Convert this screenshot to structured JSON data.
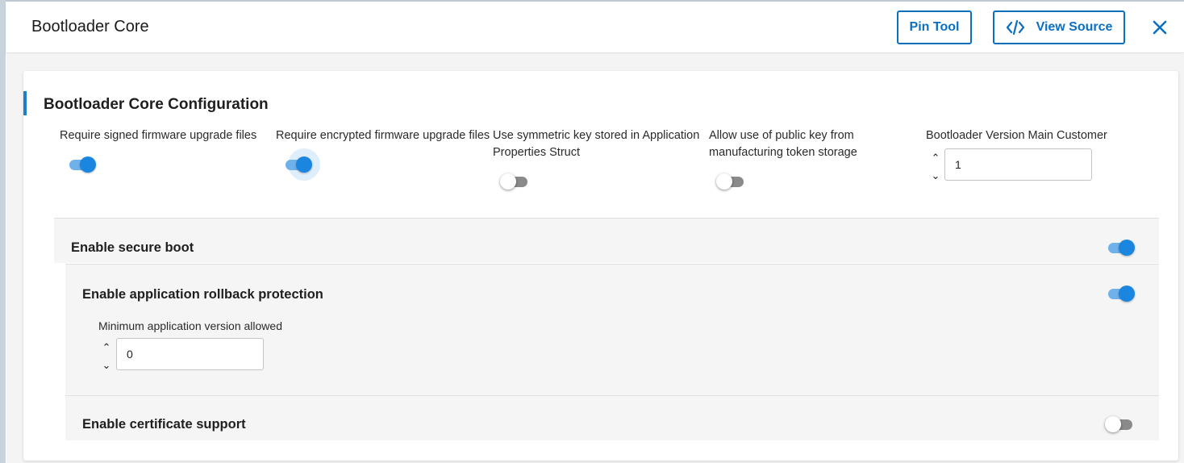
{
  "header": {
    "title": "Bootloader Core",
    "pin_tool_label": "Pin Tool",
    "view_source_label": "View Source"
  },
  "card": {
    "title": "Bootloader Core Configuration"
  },
  "options": [
    {
      "label": "Require signed firmware upgrade files",
      "enabled": true
    },
    {
      "label": "Require encrypted firmware upgrade files",
      "enabled": true,
      "focused": true
    },
    {
      "label_line1": "Use symmetric key stored in Application",
      "label_line2": "Properties Struct",
      "enabled": false
    },
    {
      "label_line1": "Allow use of public key from",
      "label_line2": "manufacturing token storage",
      "enabled": false
    }
  ],
  "version_main_customer": {
    "label": "Bootloader Version Main Customer",
    "value": "1"
  },
  "secure_boot": {
    "title": "Enable secure boot",
    "enabled": true
  },
  "rollback": {
    "title": "Enable application rollback protection",
    "enabled": true,
    "min_version_label": "Minimum application version allowed",
    "min_version_value": "0"
  },
  "certificate": {
    "title": "Enable certificate support",
    "enabled": false
  },
  "icons": {
    "stepper_up": "⌃",
    "stepper_down": "⌄"
  },
  "colors": {
    "accent": "#0c6fc0",
    "toggle_on": "#1a86e0",
    "toggle_off": "#8a8a8a"
  }
}
